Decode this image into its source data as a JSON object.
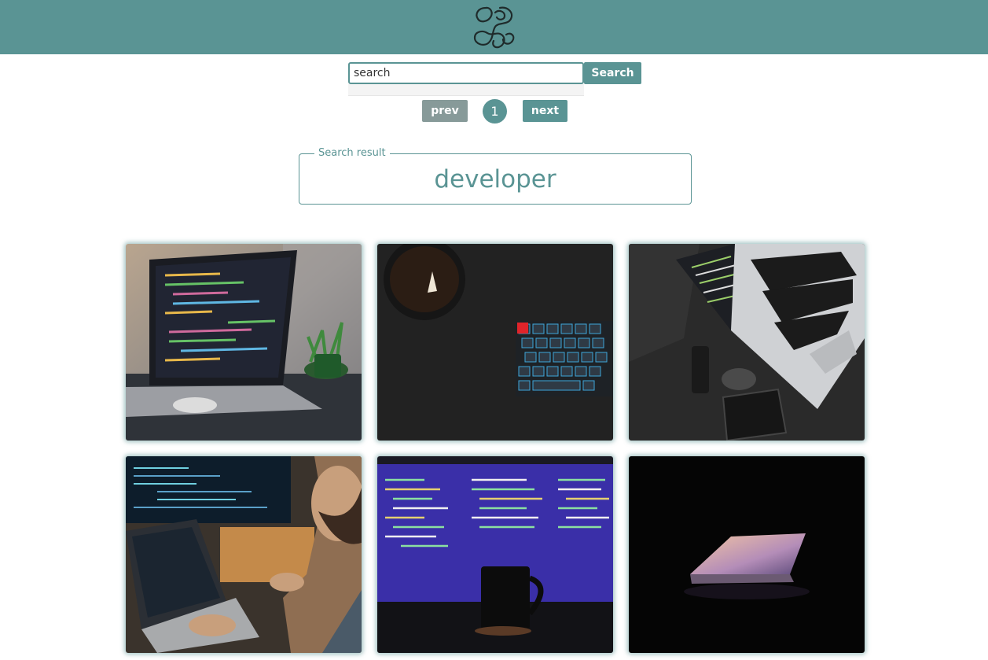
{
  "header": {
    "logo_icon": "intertwined-loops-logo",
    "background_color": "#5a9494"
  },
  "search": {
    "value": "search",
    "button_label": "Search"
  },
  "pagination": {
    "prev_label": "prev",
    "current_page": "1",
    "next_label": "next"
  },
  "result": {
    "legend": "Search result",
    "term": "developer"
  },
  "gallery": {
    "images": [
      {
        "description": "laptop with code on editor beside small plant"
      },
      {
        "description": "coffee mug and backlit mechanical keyboard on dark desk"
      },
      {
        "description": "top view of silver laptop with code, phone and mouse"
      },
      {
        "description": "bearded developer coding on laptop and monitor"
      },
      {
        "description": "monitor full of code with black mug in front"
      },
      {
        "description": "half-open laptop glowing in darkness"
      }
    ]
  },
  "colors": {
    "accent": "#5a9494",
    "prev_button": "#879a99"
  }
}
